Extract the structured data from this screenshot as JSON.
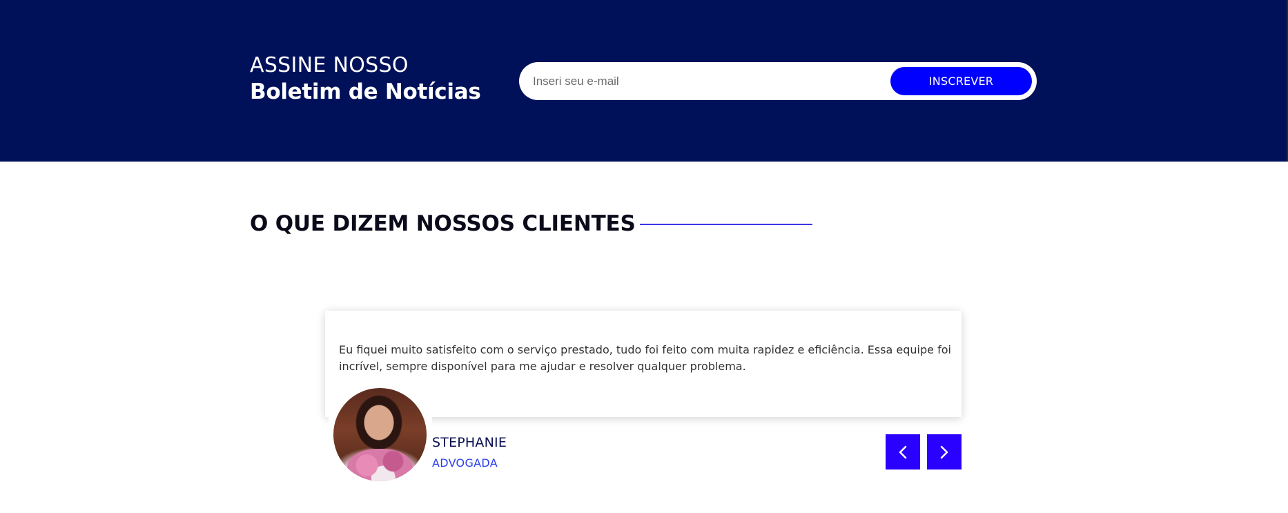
{
  "newsletter": {
    "title_line1": "ASSINE NOSSO",
    "title_line2": "Boletim de Notícias",
    "email_placeholder": "Inseri seu e-mail",
    "subscribe_label": "INSCREVER"
  },
  "testimonials": {
    "section_title": "O QUE DIZEM NOSSOS CLIENTES",
    "current": {
      "text": "Eu fiquei muito satisfeito com o serviço prestado, tudo foi feito com muita rapidez e eficiência. Essa equipe foi incrível, sempre disponível para me ajudar e resolver qualquer problema.",
      "name": "STEPHANIE",
      "role": "ADVOGADA"
    },
    "prev_icon": "chevron-left-icon",
    "next_icon": "chevron-right-icon"
  },
  "colors": {
    "newsletter_bg": "#00115a",
    "accent_blue": "#0000ff",
    "nav_button": "#2a00ff",
    "role_text": "#2b3ef0"
  }
}
